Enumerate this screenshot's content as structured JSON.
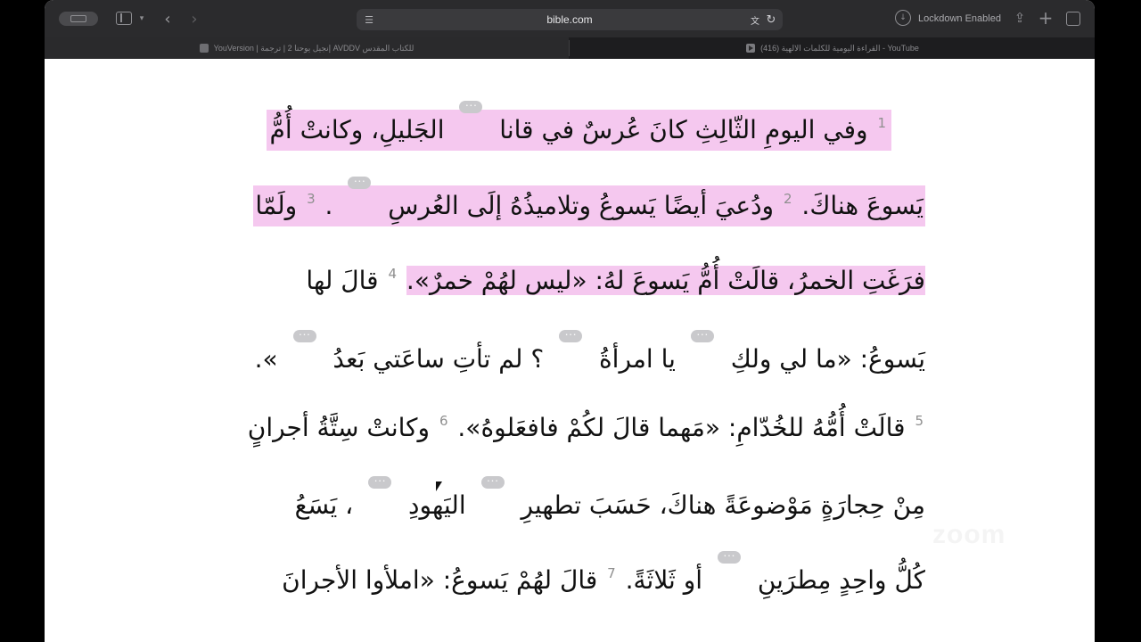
{
  "browser": {
    "url": "bible.com",
    "lockdown_label": "Lockdown Enabled",
    "tabs": [
      {
        "label": "YouVersion | إنجيل يوحنا 2 | ترجمة AVDDV للكتاب المقدس",
        "active": true
      },
      {
        "label": "(416) القراءة اليومية للكلمات الالهية - YouTube",
        "active": false
      }
    ]
  },
  "verses": {
    "line1": {
      "num1": "1",
      "a": "وفي اليومِ الثّالِثِ كانَ عُرسٌ في قانا",
      "b": "الجَليلِ، وكانتْ أُمُّ"
    },
    "line2": {
      "a": "يَسوعَ هناكَ.",
      "num2": "2",
      "b": "ودُعيَ أيضًا يَسوعُ وتلاميذُهُ إلَى العُرسِ",
      "dot": ".",
      "num3": "3",
      "c": "ولَمّا"
    },
    "line3": {
      "a": "فرَغَتِ الخمرُ، قالَتْ أُمُّ يَسوعَ لهُ: «ليس لهُمْ خمرٌ».",
      "num4": "4",
      "b": "قالَ لها"
    },
    "line4": {
      "a": "يَسوعُ: «ما لي ولكِ",
      "b": "يا امرأةُ",
      "c": "؟ لم تأتِ ساعَتي بَعدُ",
      "d": "»."
    },
    "line5": {
      "num5": "5",
      "a": "قالَتْ أُمُّهُ للخُدّامِ: «مَهما قالَ لكُمْ فافعَلوهُ».",
      "num6": "6",
      "b": "وكانتْ سِتَّةُ أجرانٍ"
    },
    "line6": {
      "a": "مِنْ حِجارَةٍ مَوْضوعَةً هناكَ، حَسَبَ تطهيرِ",
      "b": "اليَهودِ",
      "c": "، يَسَعُ"
    },
    "line7": {
      "a": "كُلُّ واحِدٍ مِطرَينِ",
      "b": "أو ثَلاثَةً.",
      "num7": "7",
      "c": "قالَ لهُمْ يَسوعُ: «املأوا الأجرانَ"
    }
  },
  "watermark": "zoom",
  "colors": {
    "highlight": "#f5c8ef",
    "toolbar": "#2b2b2d",
    "note_icon": "#c9c9cc"
  },
  "icons": [
    "sidebar-icon",
    "back-icon",
    "forward-icon",
    "page-icon",
    "translate-icon",
    "reload-icon",
    "download-icon",
    "share-icon",
    "new-tab-icon",
    "tab-overview-icon",
    "note-icon"
  ]
}
